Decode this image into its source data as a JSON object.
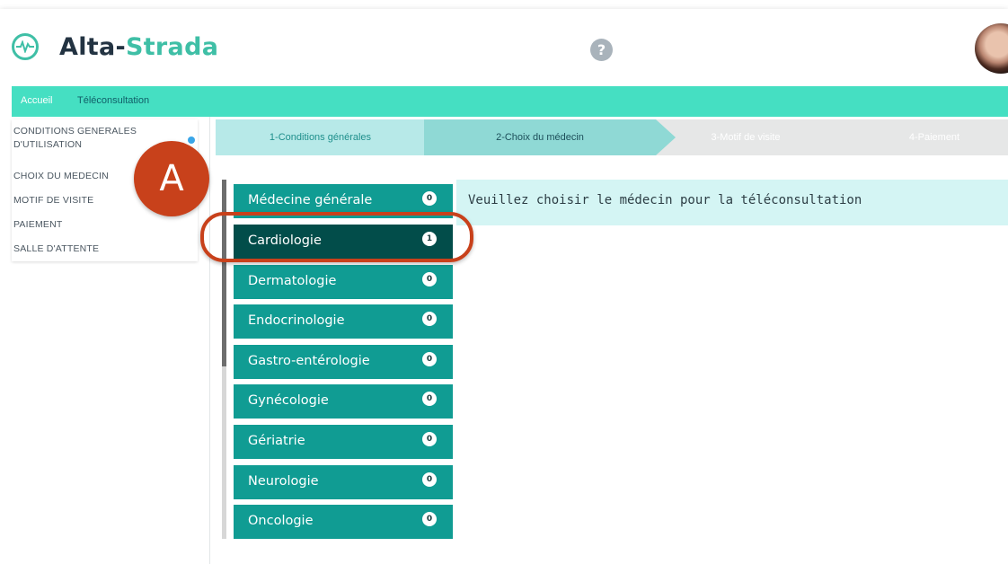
{
  "app": {
    "logo_name_part1": "Alta-",
    "logo_name_part2": "Strada",
    "help_icon_glyph": "?"
  },
  "nav": {
    "home": "Accueil",
    "teleconsultation": "Téléconsultation"
  },
  "sidebar": {
    "items": [
      {
        "label": "CONDITIONS GENERALES D'UTILISATION"
      },
      {
        "label": "CHOIX DU MEDECIN"
      },
      {
        "label": "MOTIF DE VISITE"
      },
      {
        "label": "PAIEMENT"
      },
      {
        "label": "SALLE D'ATTENTE"
      }
    ]
  },
  "steps": [
    {
      "label": "1-Conditions générales"
    },
    {
      "label": "2-Choix du médecin"
    },
    {
      "label": "3-Motif de visite"
    },
    {
      "label": "4-Paiement"
    }
  ],
  "specialties": [
    {
      "label": "Médecine générale",
      "count": "0"
    },
    {
      "label": "Cardiologie",
      "count": "1"
    },
    {
      "label": "Dermatologie",
      "count": "0"
    },
    {
      "label": "Endocrinologie",
      "count": "0"
    },
    {
      "label": "Gastro-entérologie",
      "count": "0"
    },
    {
      "label": "Gynécologie",
      "count": "0"
    },
    {
      "label": "Gériatrie",
      "count": "0"
    },
    {
      "label": "Neurologie",
      "count": "0"
    },
    {
      "label": "Oncologie",
      "count": "0"
    }
  ],
  "selected_specialty": "Cardiologie",
  "info_message": "Veuillez choisir le médecin pour la téléconsultation",
  "annotation": {
    "label": "A"
  },
  "colors": {
    "brand_green": "#3fbfa6",
    "nav_bar": "#45dfc2",
    "specialty_button": "#109c93",
    "specialty_selected": "#024d4a",
    "annotation": "#c8411b"
  }
}
